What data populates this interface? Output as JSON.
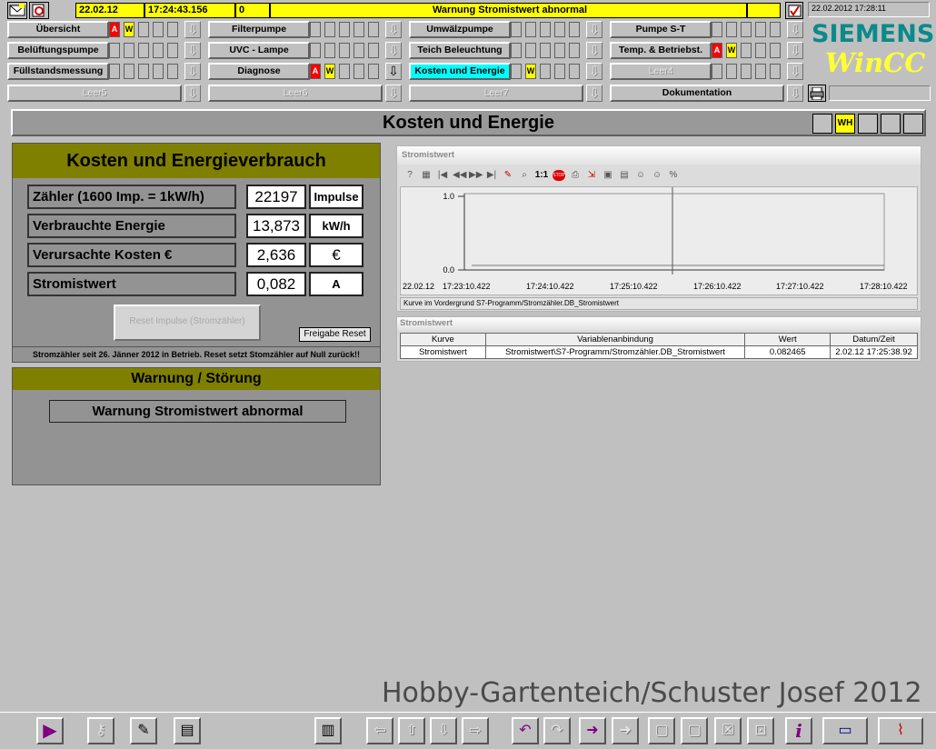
{
  "status": {
    "date": "22.02.12",
    "time": "17:24:43.156",
    "count": "0",
    "message": "Warnung Stromistwert abnormal",
    "clock": "22.02.2012 17:28:11"
  },
  "nav": {
    "row1": [
      "Übersicht",
      "Filterpumpe",
      "Umwälzpumpe",
      "Pumpe S-T"
    ],
    "row2": [
      "Belüftungspumpe",
      "UVC - Lampe",
      "Teich Beleuchtung",
      "Temp. & Betriebst."
    ],
    "row3": [
      "Füllstandsmessung",
      "Diagnose",
      "Kosten und Energie",
      "Leer4"
    ],
    "row4": [
      "Leer5",
      "Leer6",
      "Leer7",
      "Dokumentation"
    ],
    "alarm_a": "A",
    "alarm_w": "W",
    "arrow": "⇩"
  },
  "logo": {
    "brand": "SIEMENS",
    "product": "WinCC"
  },
  "page": {
    "title": "Kosten und Energie",
    "wh_label": "WH"
  },
  "cost_panel": {
    "title": "Kosten und Energieverbrauch",
    "rows": [
      {
        "label": "Zähler (1600 Imp. = 1kW/h)",
        "value": "22197",
        "unit": "Impulse"
      },
      {
        "label": "Verbrauchte Energie",
        "value": "13,873",
        "unit": "kW/h"
      },
      {
        "label": "Verursachte Kosten €",
        "value": "2,636",
        "unit": "€"
      },
      {
        "label": "Stromistwert",
        "value": "0,082",
        "unit": "A"
      }
    ],
    "reset_label": "Reset Impulse (Stromzähler)",
    "freigabe_label": "Freigabe Reset",
    "note": "Stromzähler seit 26. Jänner 2012 in Betrieb. Reset setzt Stomzähler auf Null zurück!!"
  },
  "warning_panel": {
    "title": "Warnung / Störung",
    "message": "Warnung Stromistwert abnormal"
  },
  "trend": {
    "caption": "Stromistwert",
    "status": "Kurve im Vordergrund S7-Programm/Stromzähler.DB_Stromistwert",
    "x_first_date": "22.02.12",
    "x_ticks": [
      "17:23:10.422",
      "17:24:10.422",
      "17:25:10.422",
      "17:26:10.422",
      "17:27:10.422",
      "17:28:10.422"
    ],
    "y_ticks": [
      "1.0",
      "0.0"
    ],
    "toolbar": {
      "help": "?",
      "props": "▦",
      "first": "|◀",
      "prev": "◀◀",
      "next": "▶▶",
      "last": "▶|",
      "edit": "✎",
      "zoom": "⌕",
      "one_to_one": "1:1",
      "stop": "STOP",
      "print": "⎙",
      "export": "⇲",
      "snap": "▣",
      "save": "▤",
      "user1": "☺",
      "user2": "☺",
      "percent": "%"
    }
  },
  "value_table": {
    "caption": "Stromistwert",
    "headers": [
      "Kurve",
      "Variablenanbindung",
      "Wert",
      "Datum/Zeit"
    ],
    "row": [
      "Stromistwert",
      "Stromistwert\\S7-Programm/Stromzähler.DB_Stromistwert",
      "0.082465",
      "2.02.12 17:25:38.92"
    ]
  },
  "footer": {
    "text": "Hobby-Gartenteich/Schuster Josef 2012"
  },
  "icons": {
    "alarm_list": "✉",
    "exit": "G",
    "ack": "✓",
    "printer": "⎙",
    "play": "▶",
    "key": "⚷",
    "help_book": "✎",
    "notes": "▤",
    "calc": "▥",
    "nav_left": "⇦",
    "nav_up": "⇧",
    "nav_down": "⇩",
    "nav_right": "⇨",
    "undo": "↶",
    "redo": "↷",
    "next_pic": "➜",
    "prev_pic": "➜",
    "win1": "▢",
    "win2": "▢",
    "close_win": "☒",
    "zoom_win": "⊡",
    "info": "i",
    "runtime": "▭",
    "curve": "⌇"
  },
  "colors": {
    "panel_title": "#808000",
    "alarm_red": "#ff0000",
    "warn_yellow": "#ffff00",
    "active_cyan": "#00ffff",
    "logo_teal": "#0b8a8a",
    "logo_yellow": "#ffff33"
  }
}
